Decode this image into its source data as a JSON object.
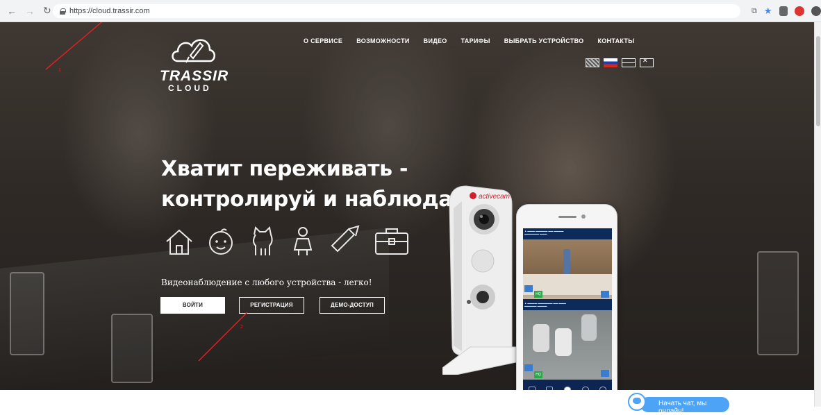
{
  "browser": {
    "back_icon": "back-arrow-icon",
    "forward_icon": "forward-arrow-icon",
    "reload_icon": "reload-icon",
    "url": "https://cloud.trassir.com"
  },
  "logo": {
    "word": "TRASSIR",
    "sub": "CLOUD"
  },
  "menu": {
    "items": [
      {
        "label": "О СЕРВИСЕ"
      },
      {
        "label": "ВОЗМОЖНОСТИ"
      },
      {
        "label": "ВИДЕО"
      },
      {
        "label": "ТАРИФЫ"
      },
      {
        "label": "ВЫБРАТЬ УСТРОЙСТВО"
      },
      {
        "label": "КОНТАКТЫ"
      }
    ]
  },
  "hero": {
    "headline_line1": "Хватит переживать -",
    "headline_line2": "контролируй и наблюдай!",
    "tagline": "Видеонаблюдение с любого устройства - легко!",
    "icons": [
      "house-icon",
      "baby-icon",
      "cat-icon",
      "nanny-icon",
      "tool-icon",
      "briefcase-icon"
    ]
  },
  "buttons": {
    "login": "ВОЙТИ",
    "register": "РЕГИСТРАЦИЯ",
    "demo": "ДЕМО-ДОСТУП"
  },
  "annotations": {
    "one": "1",
    "two": "2"
  },
  "camera": {
    "brand": "activecam"
  },
  "chat": {
    "label": "Начать чат, мы онлайн!"
  },
  "colors": {
    "annotation": "#dd2222",
    "chat": "#4da3f5"
  }
}
